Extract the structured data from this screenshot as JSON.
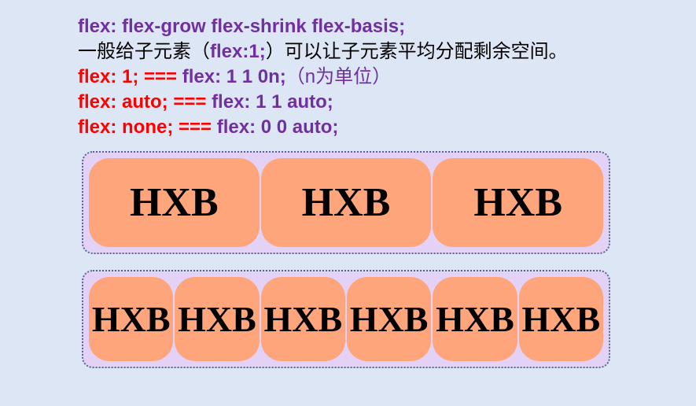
{
  "notes": {
    "line1": "flex: flex-grow flex-shrink flex-basis;",
    "line2_a": "一般给子元素（",
    "line2_b": "flex:1;",
    "line2_c": "）可以让子元素平均分配剩余空间。",
    "line3_a": "flex: 1; === ",
    "line3_b": "flex: 1 1 0n;",
    "line3_c": "（n为单位）",
    "line4_a": "flex: auto; === ",
    "line4_b": "flex: 1 1 auto;",
    "line5_a": "flex: none; === ",
    "line5_b": "flex: 0 0 auto;"
  },
  "row1": [
    "HXB",
    "HXB",
    "HXB"
  ],
  "row2": [
    "HXB",
    "HXB",
    "HXB",
    "HXB",
    "HXB",
    "HXB"
  ],
  "colors": {
    "purple": "#7030a0",
    "red": "#ff0000",
    "item_bg": "#ffa57c",
    "container_bg": "#e3d2f5",
    "page_bg": "#dde6f4"
  }
}
